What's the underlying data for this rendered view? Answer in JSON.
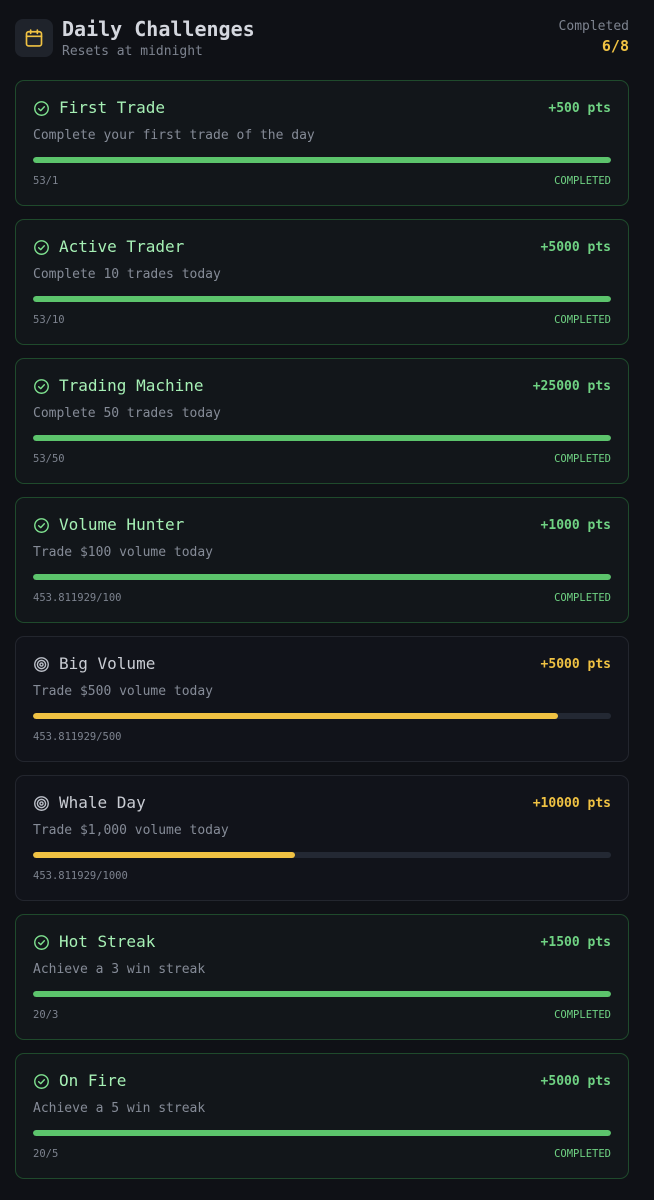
{
  "header": {
    "title": "Daily Challenges",
    "subtitle": "Resets at midnight",
    "completed_label": "Completed",
    "completed_count": "6/8",
    "icon": "calendar-icon"
  },
  "colors": {
    "background": "#0f1116",
    "completed_green": "#5cc46c",
    "pending_yellow": "#f0c243"
  },
  "challenges": [
    {
      "title": "First Trade",
      "points": "+500 pts",
      "description": "Complete your first trade of the day",
      "progress_text": "53/1",
      "progress_fraction": 1.0,
      "status": "COMPLETED",
      "completed": true,
      "icon": "check-circle-icon"
    },
    {
      "title": "Active Trader",
      "points": "+5000 pts",
      "description": "Complete 10 trades today",
      "progress_text": "53/10",
      "progress_fraction": 1.0,
      "status": "COMPLETED",
      "completed": true,
      "icon": "check-circle-icon"
    },
    {
      "title": "Trading Machine",
      "points": "+25000 pts",
      "description": "Complete 50 trades today",
      "progress_text": "53/50",
      "progress_fraction": 1.0,
      "status": "COMPLETED",
      "completed": true,
      "icon": "check-circle-icon"
    },
    {
      "title": "Volume Hunter",
      "points": "+1000 pts",
      "description": "Trade $100 volume today",
      "progress_text": "453.811929/100",
      "progress_fraction": 1.0,
      "status": "COMPLETED",
      "completed": true,
      "icon": "check-circle-icon"
    },
    {
      "title": "Big Volume",
      "points": "+5000 pts",
      "description": "Trade $500 volume today",
      "progress_text": "453.811929/500",
      "progress_fraction": 0.9076,
      "status": "",
      "completed": false,
      "icon": "target-icon"
    },
    {
      "title": "Whale Day",
      "points": "+10000 pts",
      "description": "Trade $1,000 volume today",
      "progress_text": "453.811929/1000",
      "progress_fraction": 0.4538,
      "status": "",
      "completed": false,
      "icon": "target-icon"
    },
    {
      "title": "Hot Streak",
      "points": "+1500 pts",
      "description": "Achieve a 3 win streak",
      "progress_text": "20/3",
      "progress_fraction": 1.0,
      "status": "COMPLETED",
      "completed": true,
      "icon": "check-circle-icon"
    },
    {
      "title": "On Fire",
      "points": "+5000 pts",
      "description": "Achieve a 5 win streak",
      "progress_text": "20/5",
      "progress_fraction": 1.0,
      "status": "COMPLETED",
      "completed": true,
      "icon": "check-circle-icon"
    }
  ]
}
